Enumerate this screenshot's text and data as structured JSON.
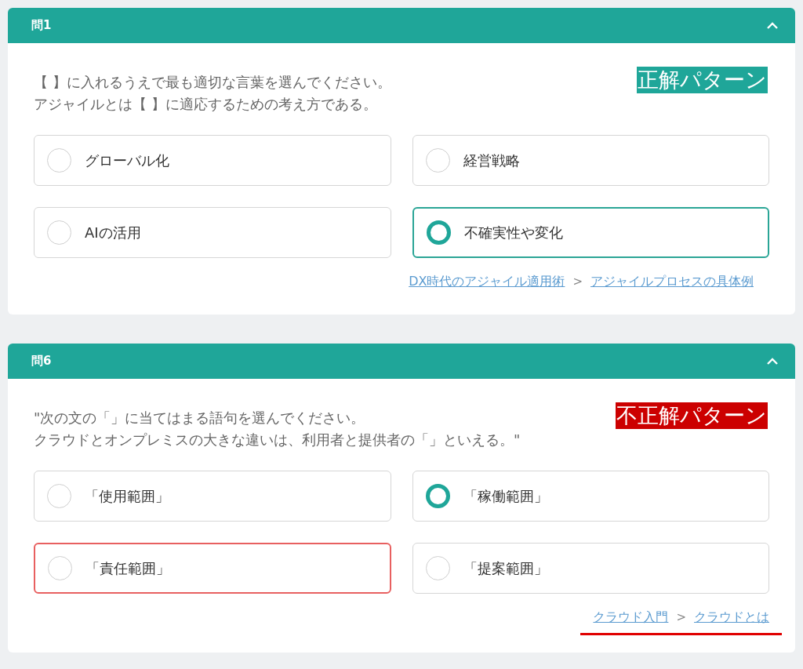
{
  "questions": [
    {
      "title": "問1",
      "expanded": true,
      "badge": {
        "label": "正解パターン",
        "kind": "correct"
      },
      "prompt": [
        "【 】に入れるうえで最も適切な言葉を選んでください。",
        "アジャイルとは【 】に適応するための考え方である。"
      ],
      "options": [
        {
          "label": "グローバル化",
          "selected": false,
          "answered_correct": false,
          "missed_answer": false
        },
        {
          "label": "経営戦略",
          "selected": false,
          "answered_correct": false,
          "missed_answer": false
        },
        {
          "label": "AIの活用",
          "selected": false,
          "answered_correct": false,
          "missed_answer": false
        },
        {
          "label": "不確実性や変化",
          "selected": true,
          "answered_correct": true,
          "missed_answer": false
        }
      ],
      "breadcrumb": {
        "underlined": false,
        "links": [
          "DX時代のアジャイル適用術",
          "アジャイルプロセスの具体例"
        ],
        "separator": ">"
      }
    },
    {
      "title": "問6",
      "expanded": true,
      "badge": {
        "label": "不正解パターン",
        "kind": "incorrect"
      },
      "prompt": [
        "\"次の文の「」に当てはまる語句を選んでください。",
        "クラウドとオンプレミスの大きな違いは、利用者と提供者の「」といえる。\""
      ],
      "options": [
        {
          "label": "「使用範囲」",
          "selected": false,
          "answered_correct": false,
          "missed_answer": false
        },
        {
          "label": "「稼働範囲」",
          "selected": true,
          "answered_correct": false,
          "missed_answer": false
        },
        {
          "label": "「責任範囲」",
          "selected": false,
          "answered_correct": false,
          "missed_answer": true
        },
        {
          "label": "「提案範囲」",
          "selected": false,
          "answered_correct": false,
          "missed_answer": false
        }
      ],
      "breadcrumb": {
        "underlined": true,
        "links": [
          "クラウド入門",
          "クラウドとは"
        ],
        "separator": ">"
      }
    }
  ]
}
